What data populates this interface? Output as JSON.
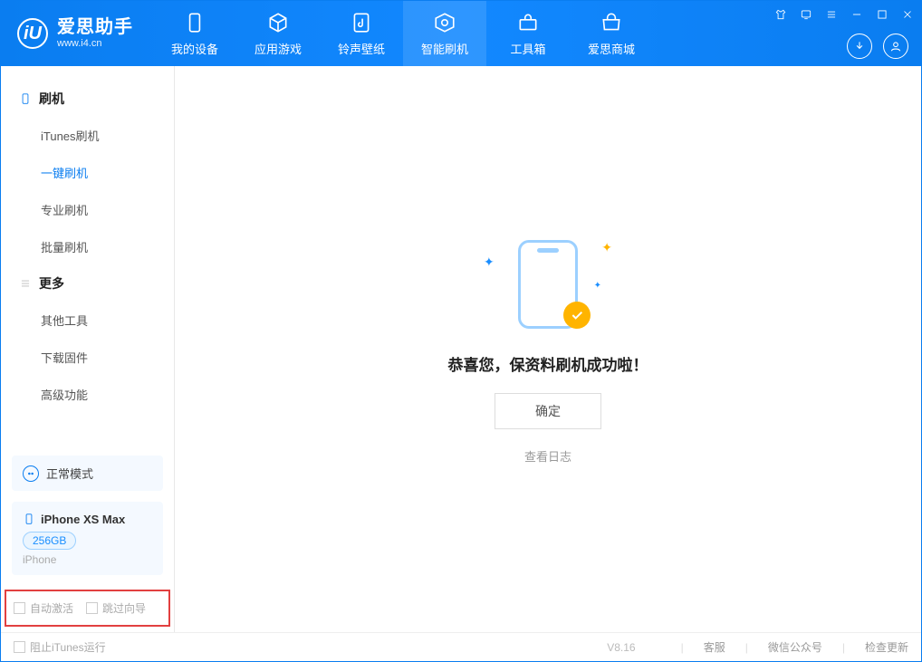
{
  "app": {
    "name": "爱思助手",
    "domain": "www.i4.cn"
  },
  "nav": {
    "my_device": "我的设备",
    "apps_games": "应用游戏",
    "ring_wall": "铃声壁纸",
    "smart_flash": "智能刷机",
    "toolbox": "工具箱",
    "store": "爱思商城"
  },
  "sidebar": {
    "section_flash": "刷机",
    "itunes_flash": "iTunes刷机",
    "one_key_flash": "一键刷机",
    "pro_flash": "专业刷机",
    "batch_flash": "批量刷机",
    "section_more": "更多",
    "other_tools": "其他工具",
    "download_fw": "下载固件",
    "advanced": "高级功能",
    "mode": "正常模式",
    "device_name": "iPhone XS Max",
    "capacity": "256GB",
    "device_type": "iPhone",
    "chk_auto_activate": "自动激活",
    "chk_skip_guide": "跳过向导"
  },
  "main": {
    "success_msg": "恭喜您，保资料刷机成功啦！",
    "ok_btn": "确定",
    "view_log": "查看日志"
  },
  "footer": {
    "block_itunes": "阻止iTunes运行",
    "version": "V8.16",
    "support": "客服",
    "wechat": "微信公众号",
    "check_update": "检查更新"
  }
}
